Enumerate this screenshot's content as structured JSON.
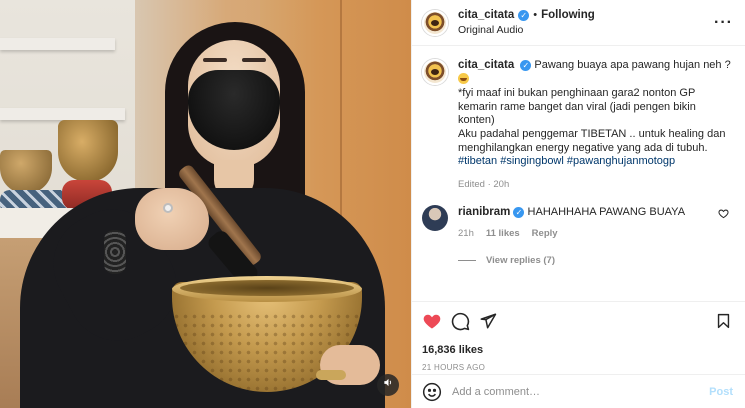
{
  "post": {
    "username": "cita_citata",
    "following_label": "Following",
    "audio_label": "Original Audio",
    "more_icon": "more-options-icon",
    "sound_icon": "speaker-icon"
  },
  "caption": {
    "username": "cita_citata",
    "line1": "Pawang buaya apa pawang hujan neh ?",
    "line2": "*fyi maaf ini bukan penghinaan gara2 nonton GP kemarin rame banget dan viral (jadi pengen bikin konten)",
    "line3": "Aku padahal penggemar TIBETAN .. untuk healing dan menghilangkan energy negative yang ada di tubuh.",
    "tag1": "#tibetan",
    "tag2": "#singingbowl",
    "tag3": "#pawanghujanmotogp",
    "meta": "Edited · 20h"
  },
  "comment": {
    "username": "rianibram",
    "text": "HAHAHHAHA PAWANG BUAYA",
    "time": "21h",
    "likes": "11 likes",
    "reply": "Reply",
    "view_replies": "View replies (7)"
  },
  "actions": {
    "likes": "16,836 likes",
    "timestamp": "21 HOURS AGO"
  },
  "add_comment": {
    "placeholder": "Add a comment…",
    "post_label": "Post"
  },
  "colors": {
    "like_red": "#ed4956",
    "verified_blue": "#3897f0",
    "link_blue": "#00376b",
    "post_disabled": "#b2dffc"
  }
}
